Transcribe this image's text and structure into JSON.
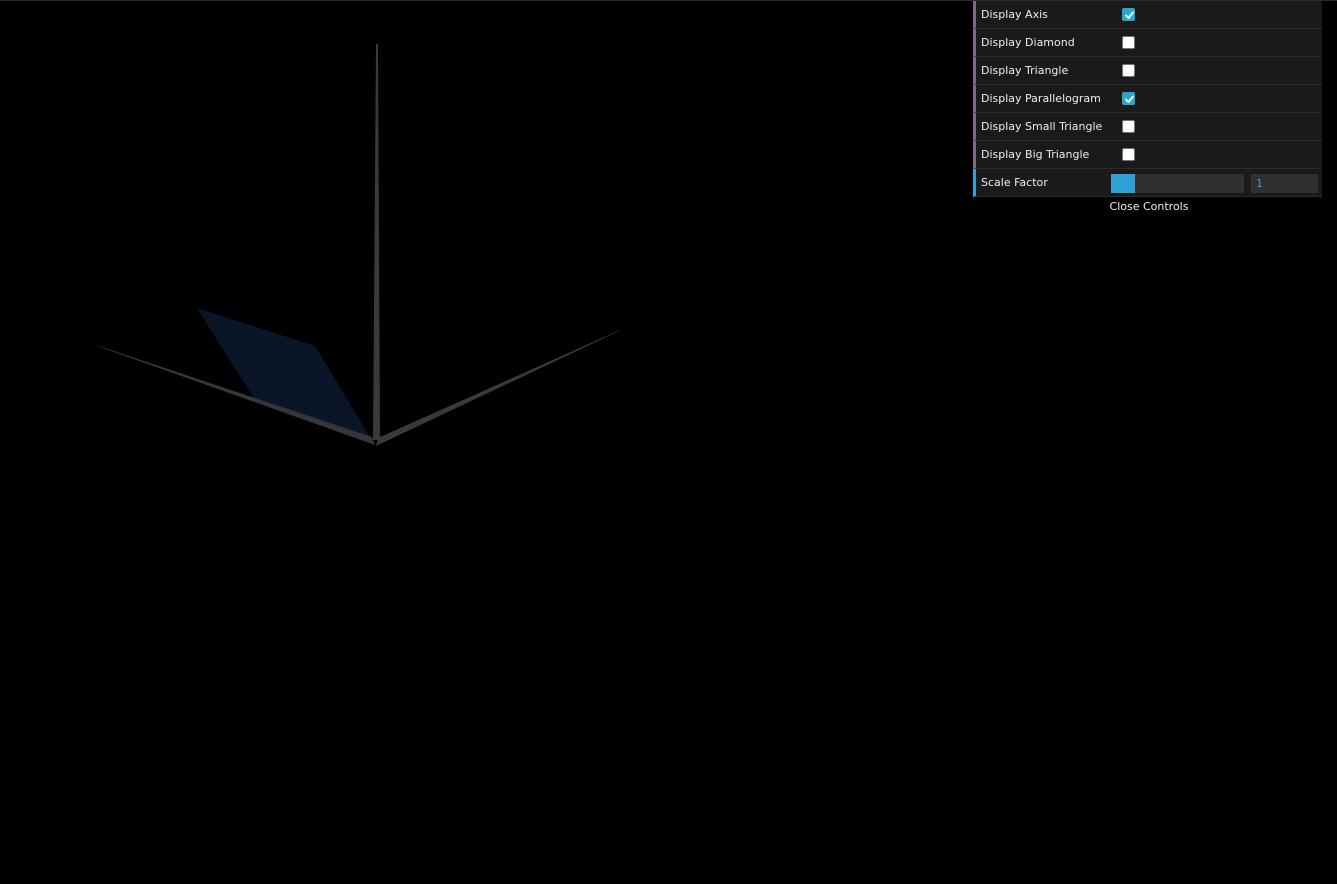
{
  "controls": {
    "items": [
      {
        "label": "Display Axis",
        "checked": true
      },
      {
        "label": "Display Diamond",
        "checked": false
      },
      {
        "label": "Display Triangle",
        "checked": false
      },
      {
        "label": "Display Parallelogram",
        "checked": true
      },
      {
        "label": "Display Small Triangle",
        "checked": false
      },
      {
        "label": "Display Big Triangle",
        "checked": false
      }
    ],
    "scale": {
      "label": "Scale Factor",
      "value": "1",
      "fill_fraction": 0.18
    },
    "close_label": "Close Controls"
  },
  "colors": {
    "background": "#000000",
    "axis": "#3a3a3a",
    "parallelogram": "#0a1628",
    "accent": "#2fa1d6",
    "checkbox_border_accent": "#806787"
  }
}
